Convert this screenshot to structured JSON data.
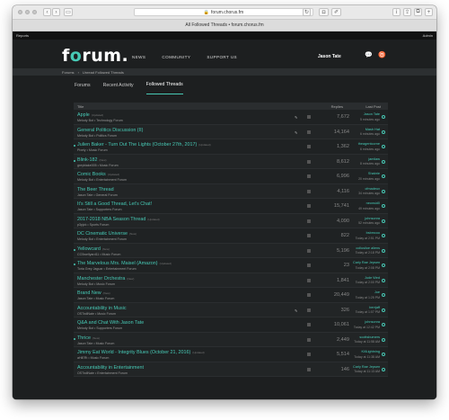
{
  "browser": {
    "url": "forum.chorus.fm",
    "tab_title": "All Followed Threads • forum.chorus.fm"
  },
  "ubar": {
    "left": "Reports",
    "right": "Admin"
  },
  "header": {
    "logo_pre": "f",
    "logo_o": "o",
    "logo_post": "rum.",
    "nav": [
      "NEWS",
      "COMMUNITY",
      "SUPPORT US"
    ],
    "username": "Jason Tate",
    "accent_color": "#47c9b5"
  },
  "breadcrumbs": [
    "Forums",
    "Unread Followed Threads"
  ],
  "tabs": [
    "Forums",
    "Recent Activity",
    "Followed Threads"
  ],
  "active_tab": "Followed Threads",
  "table": {
    "columns": {
      "title": "Title",
      "replies": "Replies",
      "last_post": "Last Post"
    },
    "rows": [
      {
        "title": "Apple",
        "tag": "(Updated)",
        "meta": "Melody Bot • Technology Forum",
        "replies": "7,672",
        "last_user": "Jason Tate",
        "last_time": "5 minutes ago",
        "unread": false,
        "pinned": true
      },
      {
        "title": "General Politics Discussion (II)",
        "tag": "",
        "meta": "Melody Bot • Politics Forum",
        "replies": "14,164",
        "last_user": "Mash Hat",
        "last_time": "6 minutes ago",
        "unread": false,
        "pinned": true
      },
      {
        "title": "Julien Baker - Turn Out The Lights (October 27th, 2017)",
        "tag": "(Updated)",
        "meta": "Pixely • Music Forum",
        "replies": "1,362",
        "last_user": "theagentcorne",
        "last_time": "6 minutes ago",
        "unread": true,
        "pinned": false
      },
      {
        "title": "Blink-182",
        "tag": "(New)",
        "meta": "greyblake005 • Music Forum",
        "replies": "8,612",
        "last_user": "jamilaw",
        "last_time": "8 minutes ago",
        "unread": true,
        "pinned": false
      },
      {
        "title": "Comic Books",
        "tag": "(Updated)",
        "meta": "Melody Bot • Entertainment Forum",
        "replies": "6,996",
        "last_user": "Shabrie",
        "last_time": "20 minutes ago",
        "unread": false,
        "pinned": false
      },
      {
        "title": "The Beer Thread",
        "tag": "",
        "meta": "Jason Tate • General Forum",
        "replies": "4,116",
        "last_user": "cfmadeux",
        "last_time": "34 minutes ago",
        "unread": false,
        "pinned": false
      },
      {
        "title": "It's Still a Good Thread, Let's Chat!",
        "tag": "",
        "meta": "Jason Tate • Supporters Forum",
        "replies": "15,741",
        "last_user": "neonsid0",
        "last_time": "49 minutes ago",
        "unread": false,
        "pinned": false
      },
      {
        "title": "2017-2018 NBA Season Thread",
        "tag": "(Updated)",
        "meta": "p3pjzk • Sports Forum",
        "replies": "4,090",
        "last_user": "johnsonra",
        "last_time": "52 minutes ago",
        "unread": false,
        "pinned": false
      },
      {
        "title": "DC Cinematic Universe",
        "tag": "(New)",
        "meta": "Melody Bot • Entertainment Forum",
        "replies": "822",
        "last_user": "bsbmcoo",
        "last_time": "Today at 2:51 PM",
        "unread": false,
        "pinned": false
      },
      {
        "title": "Yellowcard",
        "tag": "(New)",
        "meta": "CO3wellyard11 • Music Forum",
        "replies": "5,196",
        "last_user": "collusiloe aliens",
        "last_time": "Today at 2:18 PM",
        "unread": true,
        "pinned": false
      },
      {
        "title": "The Marvelous Mrs. Maisel (Amazon)",
        "tag": "(Updated)",
        "meta": "Toria Grey Jaguar • Entertainment Forum",
        "replies": "23",
        "last_user": "Carly Rae Jepsen",
        "last_time": "Today at 2:08 PM",
        "unread": true,
        "pinned": false
      },
      {
        "title": "Manchester Orchestra",
        "tag": "(New)",
        "meta": "Melody Bot • Music Forum",
        "replies": "1,841",
        "last_user": "Jude Wed",
        "last_time": "Today at 2:00 PM",
        "unread": false,
        "pinned": false
      },
      {
        "title": "Brand New",
        "tag": "(New)",
        "meta": "Jason Tate • Music Forum",
        "replies": "20,449",
        "last_user": "Joe",
        "last_time": "Today at 1:25 PM",
        "unread": false,
        "pinned": false
      },
      {
        "title": "Accountability in Music",
        "tag": "",
        "meta": "OSTwilNate • Music Forum",
        "replies": "326",
        "last_user": "berrjaff",
        "last_time": "Today at 1:07 PM",
        "unread": false,
        "pinned": true
      },
      {
        "title": "Q&A and Chat With Jason Tate",
        "tag": "",
        "meta": "Melody Bot • Supporters Forum",
        "replies": "10,061",
        "last_user": "johnsonra",
        "last_time": "Today at 12:42 PM",
        "unread": false,
        "pinned": false
      },
      {
        "title": "Thrice",
        "tag": "(New)",
        "meta": "Jason Tate • Music Forum",
        "replies": "2,449",
        "last_user": "scottsbumers",
        "last_time": "Today at 11:58 AM",
        "unread": true,
        "pinned": false
      },
      {
        "title": "Jimmy Eat World - Integrity Blues (October 21, 2016)",
        "tag": "(Updated)",
        "meta": "aHiERt • Music Forum",
        "replies": "5,514",
        "last_user": "KillLightning",
        "last_time": "Today at 11:38 AM",
        "unread": false,
        "pinned": false
      },
      {
        "title": "Accountability in Entertainment",
        "tag": "",
        "meta": "OSTwilNate • Entertainment Forum",
        "replies": "146",
        "last_user": "Carly Rae Jepsen",
        "last_time": "Today at 11:13 AM",
        "unread": false,
        "pinned": false
      }
    ]
  }
}
